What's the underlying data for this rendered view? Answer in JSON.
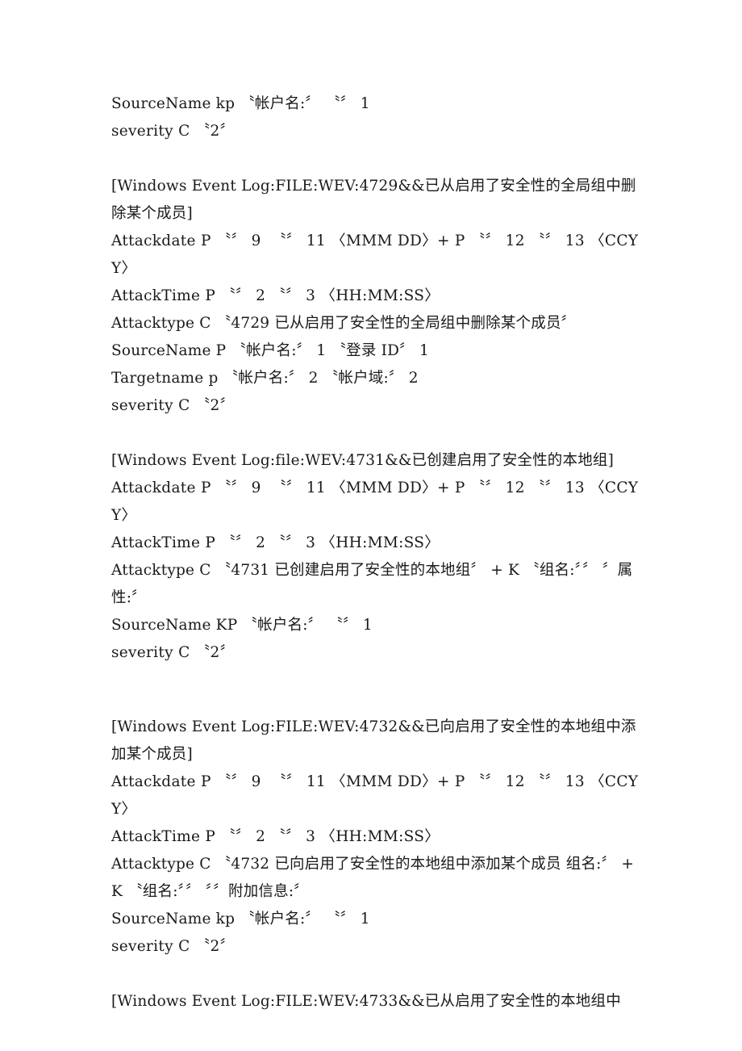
{
  "document": {
    "page_background": "#ffffff",
    "text_color": "#1a1a1a",
    "blocks": [
      {
        "id": "block-4728-tail",
        "type": "rule-fragment",
        "lines": [
          "SourceName kp 〝帐户名:〞 〝〞 1",
          "severity C 〝2〞"
        ]
      },
      {
        "id": "block-4729",
        "type": "rule-definition",
        "event_id": "4729",
        "header": "[Windows Event Log:FILE:WEV:4729&&已从启用了安全性的全局组中删除某个成员]",
        "lines": [
          "[Windows Event Log:FILE:WEV:4729&&已从启用了安全性的全局组中删除某个成员]",
          "Attackdate P 〝〞 9  〝〞 11 〈MMM DD〉+ P 〝〞 12 〝〞 13 〈CCYY〉",
          "AttackTime P 〝〞 2 〝〞 3 〈HH:MM:SS〉",
          "Attacktype C 〝4729 已从启用了安全性的全局组中删除某个成员〞",
          "SourceName P 〝帐户名:〞 1 〝登录 ID〞 1",
          "Targetname p 〝帐户名:〞 2 〝帐户域:〞 2",
          "severity C 〝2〞"
        ]
      },
      {
        "id": "block-4731",
        "type": "rule-definition",
        "event_id": "4731",
        "header": "[Windows Event Log:file:WEV:4731&&已创建启用了安全性的本地组]",
        "lines": [
          "[Windows Event Log:file:WEV:4731&&已创建启用了安全性的本地组]",
          "Attackdate P 〝〞 9  〝〞 11 〈MMM DD〉+ P 〝〞 12 〝〞 13 〈CCYY〉",
          "AttackTime P 〝〞 2 〝〞 3 〈HH:MM:SS〉",
          "Attacktype C 〝4731 已创建启用了安全性的本地组〞 + K 〝组名:〞〞 〞属性:〞",
          "SourceName KP 〝帐户名:〞 〝〞 1",
          "severity C 〝2〞"
        ]
      },
      {
        "id": "block-4732",
        "type": "rule-definition",
        "event_id": "4732",
        "header": "[Windows Event Log:FILE:WEV:4732&&已向启用了安全性的本地组中添加某个成员]",
        "lines": [
          "[Windows Event Log:FILE:WEV:4732&&已向启用了安全性的本地组中添加某个成员]",
          "Attackdate P 〝〞 9  〝〞 11 〈MMM DD〉+ P 〝〞 12 〝〞 13 〈CCYY〉",
          "AttackTime P 〝〞 2 〝〞 3 〈HH:MM:SS〉",
          "Attacktype C 〝4732 已向启用了安全性的本地组中添加某个成员 组名:〞 + K 〝组名:〞〞 〞〞附加信息:〞",
          "SourceName kp 〝帐户名:〞 〝〞 1",
          "severity C 〝2〞"
        ]
      },
      {
        "id": "block-4733",
        "type": "rule-definition-partial",
        "event_id": "4733",
        "header": "[Windows Event Log:FILE:WEV:4733&&已从启用了安全性的本地组中",
        "lines": [
          "[Windows Event Log:FILE:WEV:4733&&已从启用了安全性的本地组中"
        ]
      }
    ],
    "flat_lines": [
      {
        "key": "l01",
        "text": "SourceName kp 〝帐户名:〞 〝〞 1"
      },
      {
        "key": "l02",
        "text": "severity C 〝2〞"
      },
      {
        "key": "l03",
        "text": ""
      },
      {
        "key": "l04",
        "text": "[Windows Event Log:FILE:WEV:4729&&已从启用了安全性的全局组中删除某个成员]"
      },
      {
        "key": "l05",
        "text": "Attackdate P 〝〞 9  〝〞 11 〈MMM DD〉+ P 〝〞 12 〝〞 13 〈CCYY〉"
      },
      {
        "key": "l06",
        "text": "AttackTime P 〝〞 2 〝〞 3 〈HH:MM:SS〉"
      },
      {
        "key": "l07",
        "text": "Attacktype C 〝4729 已从启用了安全性的全局组中删除某个成员〞"
      },
      {
        "key": "l08",
        "text": "SourceName P 〝帐户名:〞 1 〝登录 ID〞 1"
      },
      {
        "key": "l09",
        "text": "Targetname p 〝帐户名:〞 2 〝帐户域:〞 2"
      },
      {
        "key": "l10",
        "text": "severity C 〝2〞"
      },
      {
        "key": "l11",
        "text": ""
      },
      {
        "key": "l12",
        "text": "[Windows Event Log:file:WEV:4731&&已创建启用了安全性的本地组]"
      },
      {
        "key": "l13",
        "text": "Attackdate P 〝〞 9  〝〞 11 〈MMM DD〉+ P 〝〞 12 〝〞 13 〈CCYY〉"
      },
      {
        "key": "l14",
        "text": "AttackTime P 〝〞 2 〝〞 3 〈HH:MM:SS〉"
      },
      {
        "key": "l15",
        "text": "Attacktype C 〝4731 已创建启用了安全性的本地组〞 + K 〝组名:〞〞 〞属性:〞"
      },
      {
        "key": "l16",
        "text": "SourceName KP 〝帐户名:〞 〝〞 1"
      },
      {
        "key": "l17",
        "text": "severity C 〝2〞"
      },
      {
        "key": "l18",
        "text": ""
      },
      {
        "key": "l19",
        "text": "[Windows Event Log:FILE:WEV:4732&&已向启用了安全性的本地组中添加某个成员]"
      },
      {
        "key": "l20",
        "text": "Attackdate P 〝〞 9  〝〞 11 〈MMM DD〉+ P 〝〞 12 〝〞 13 〈CCYY〉"
      },
      {
        "key": "l21",
        "text": "AttackTime P 〝〞 2 〝〞 3 〈HH:MM:SS〉"
      },
      {
        "key": "l22",
        "text": "Attacktype C 〝4732 已向启用了安全性的本地组中添加某个成员 组名:〞 + K 〝组名:〞〞 〞〞附加信息:〞"
      },
      {
        "key": "l23",
        "text": "SourceName kp 〝帐户名:〞 〝〞 1"
      },
      {
        "key": "l24",
        "text": "severity C 〝2〞"
      },
      {
        "key": "l25",
        "text": ""
      },
      {
        "key": "l26",
        "text": "[Windows Event Log:FILE:WEV:4733&&已从启用了安全性的本地组中"
      }
    ]
  }
}
